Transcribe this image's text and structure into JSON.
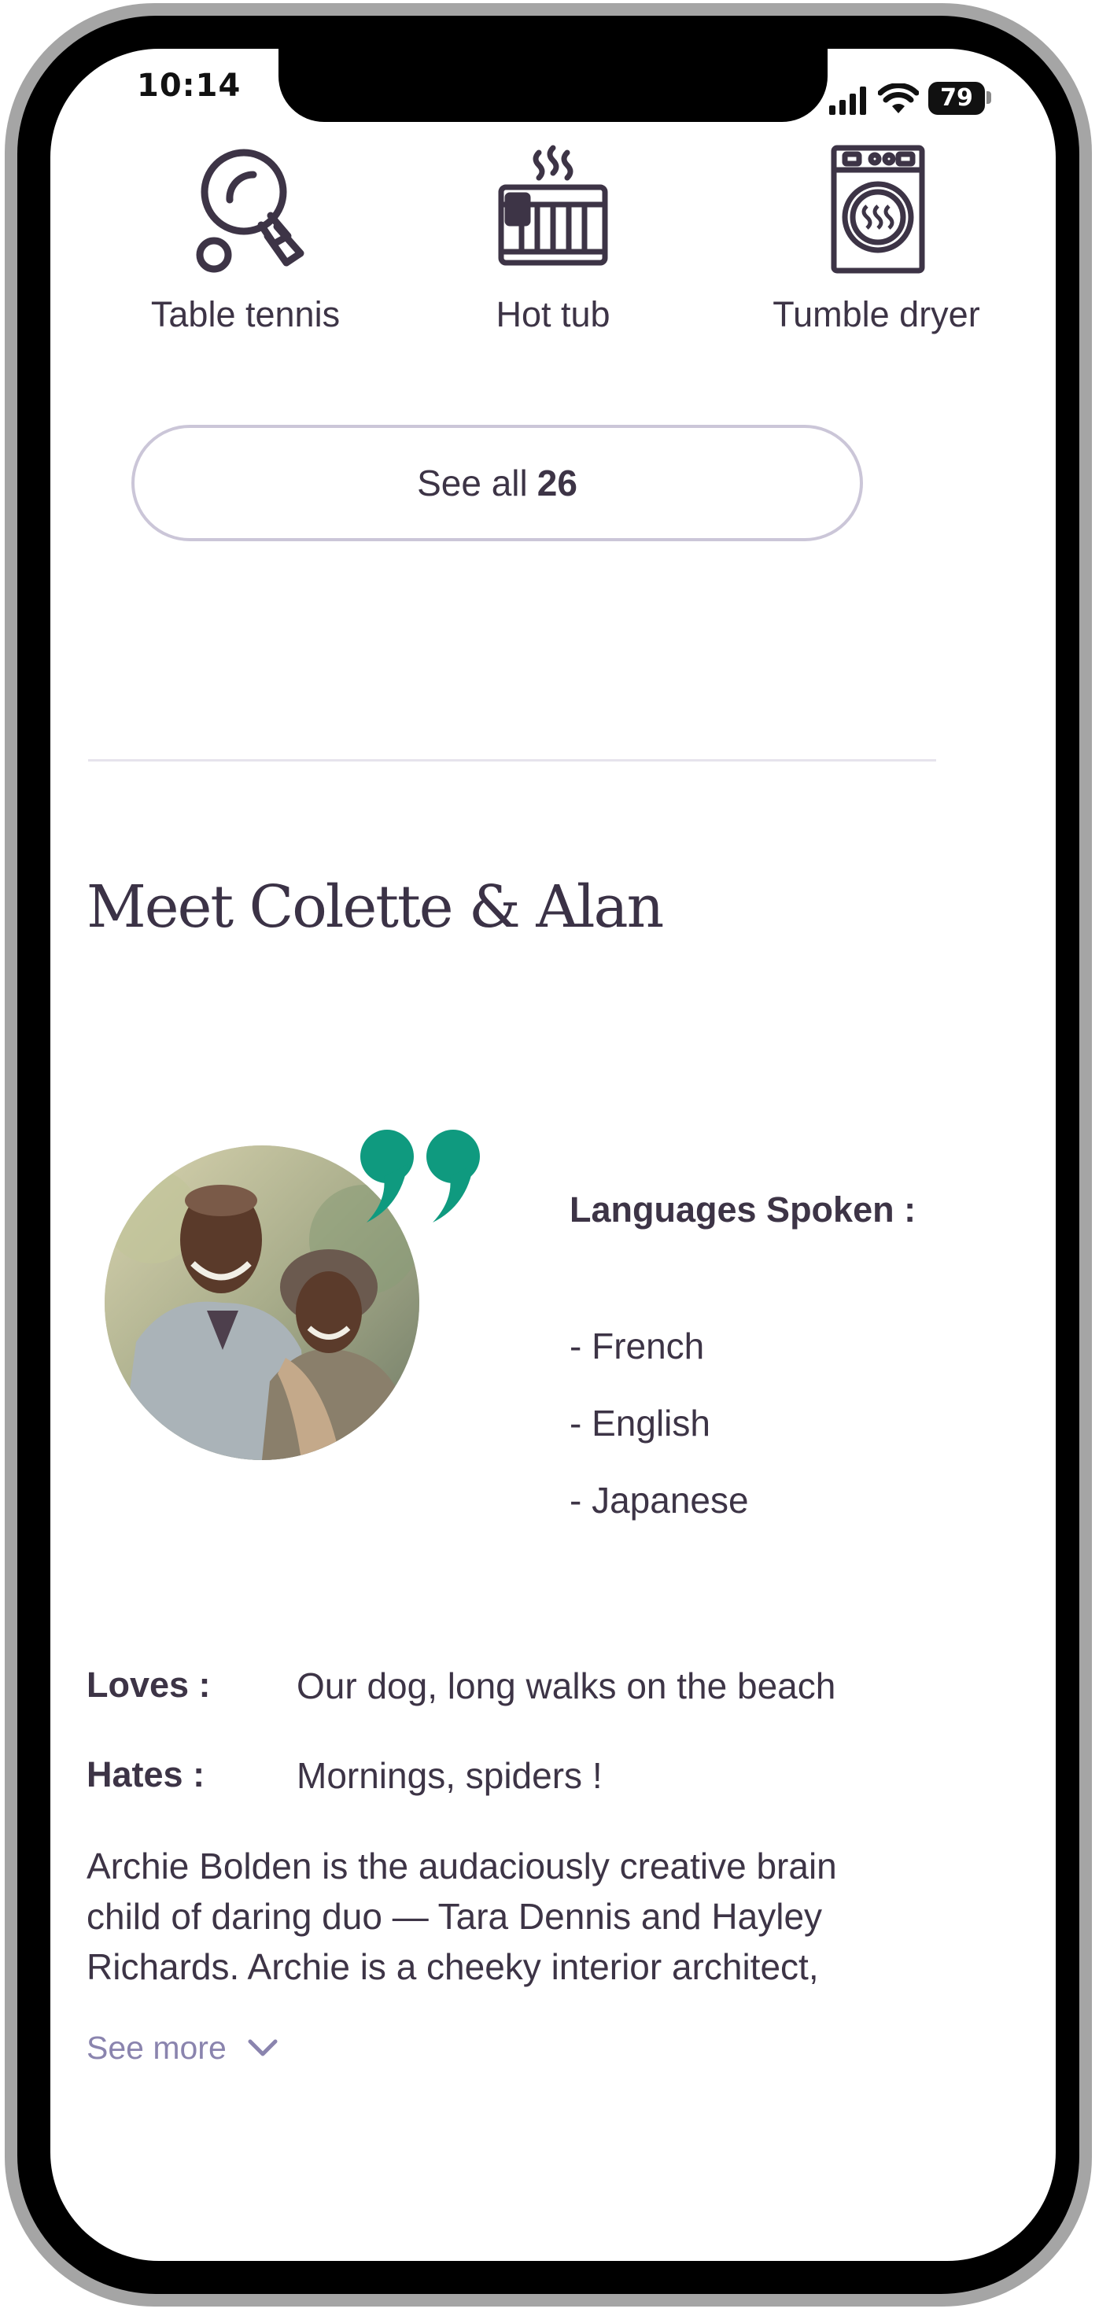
{
  "status_bar": {
    "time": "10:14",
    "battery": "79"
  },
  "amenities": [
    {
      "label": "Table tennis",
      "icon": "table-tennis-icon"
    },
    {
      "label": "Hot tub",
      "icon": "hot-tub-icon"
    },
    {
      "label": "Tumble dryer",
      "icon": "tumble-dryer-icon"
    }
  ],
  "see_all": {
    "prefix": "See all",
    "count": "26"
  },
  "host": {
    "title": "Meet Colette & Alan",
    "languages_title": "Languages Spoken :",
    "languages": [
      "- French",
      "- English",
      "- Japanese"
    ],
    "loves_label": "Loves :",
    "loves_value": "Our dog, long walks on the beach",
    "hates_label": "Hates :",
    "hates_value": "Mornings, spiders !",
    "bio": "Archie Bolden is the audaciously creative brain child of daring duo — Tara Dennis and Hayley Richards. Archie is a cheeky interior architect,",
    "see_more": "See more"
  },
  "colors": {
    "accent_quote": "#0f9a7f",
    "text": "#3d3446",
    "link": "#8a84ae",
    "button_border": "#cbc6d8"
  }
}
